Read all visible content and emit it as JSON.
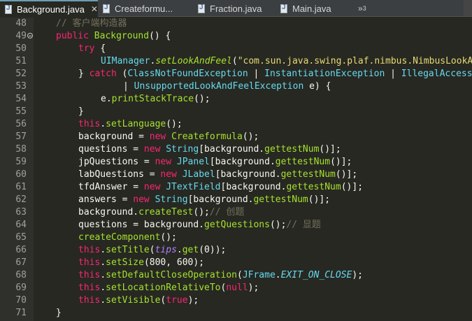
{
  "tabs": [
    {
      "label": "Background.java",
      "active": true,
      "closable": true
    },
    {
      "label": "Createformu...",
      "active": false,
      "closable": false
    },
    {
      "label": "Fraction.java",
      "active": false,
      "closable": false
    },
    {
      "label": "Main.java",
      "active": false,
      "closable": false
    }
  ],
  "overflow_label": "»",
  "overflow_count": "3",
  "colors": {
    "keyword": "#f92672",
    "type": "#66d9ef",
    "string": "#e6db74",
    "method": "#a6e22e",
    "comment": "#75715e",
    "background": "#272822"
  },
  "lines": [
    {
      "num": "48",
      "indent": 0,
      "tokens": [
        [
          "c",
          "// 客户端构造器"
        ]
      ]
    },
    {
      "num": "49",
      "fold": true,
      "indent": 0,
      "tokens": [
        [
          "k",
          "public "
        ],
        [
          "m",
          "Background"
        ],
        [
          "p",
          "() {"
        ]
      ]
    },
    {
      "num": "50",
      "indent": 1,
      "tokens": [
        [
          "k",
          "try "
        ],
        [
          "p",
          "{"
        ]
      ]
    },
    {
      "num": "51",
      "indent": 2,
      "tokens": [
        [
          "t",
          "UIManager"
        ],
        [
          "p",
          "."
        ],
        [
          "s",
          "setLookAndFeel"
        ],
        [
          "p",
          "("
        ],
        [
          "str",
          "\"com.sun.java.swing.plaf.nimbus.NimbusLookAndFeel\""
        ],
        [
          "p",
          ");"
        ]
      ]
    },
    {
      "num": "52",
      "indent": 1,
      "tokens": [
        [
          "p",
          "} "
        ],
        [
          "k",
          "catch "
        ],
        [
          "p",
          "("
        ],
        [
          "t",
          "ClassNotFoundException"
        ],
        [
          "p",
          " | "
        ],
        [
          "t",
          "InstantiationException"
        ],
        [
          "p",
          " | "
        ],
        [
          "t",
          "IllegalAccessException"
        ]
      ]
    },
    {
      "num": "53",
      "indent": 3,
      "tokens": [
        [
          "p",
          "| "
        ],
        [
          "t",
          "UnsupportedLookAndFeelException"
        ],
        [
          "p",
          " e) {"
        ]
      ]
    },
    {
      "num": "54",
      "indent": 2,
      "tokens": [
        [
          "p",
          "e."
        ],
        [
          "m",
          "printStackTrace"
        ],
        [
          "p",
          "();"
        ]
      ]
    },
    {
      "num": "55",
      "indent": 1,
      "tokens": [
        [
          "p",
          "}"
        ]
      ]
    },
    {
      "num": "56",
      "indent": 1,
      "tokens": [
        [
          "k",
          "this"
        ],
        [
          "p",
          "."
        ],
        [
          "m",
          "setLanguage"
        ],
        [
          "p",
          "();"
        ]
      ]
    },
    {
      "num": "57",
      "indent": 1,
      "tokens": [
        [
          "p",
          "background = "
        ],
        [
          "k",
          "new "
        ],
        [
          "m",
          "Createformula"
        ],
        [
          "p",
          "();"
        ]
      ]
    },
    {
      "num": "58",
      "indent": 1,
      "tokens": [
        [
          "p",
          "questions = "
        ],
        [
          "k",
          "new "
        ],
        [
          "t",
          "String"
        ],
        [
          "p",
          "[background."
        ],
        [
          "m",
          "gettestNum"
        ],
        [
          "p",
          "()];"
        ]
      ]
    },
    {
      "num": "59",
      "indent": 1,
      "tokens": [
        [
          "p",
          "jpQuestions = "
        ],
        [
          "k",
          "new "
        ],
        [
          "t",
          "JPanel"
        ],
        [
          "p",
          "[background."
        ],
        [
          "m",
          "gettestNum"
        ],
        [
          "p",
          "()];"
        ]
      ]
    },
    {
      "num": "60",
      "indent": 1,
      "tokens": [
        [
          "p",
          "labQuestions = "
        ],
        [
          "k",
          "new "
        ],
        [
          "t",
          "JLabel"
        ],
        [
          "p",
          "[background."
        ],
        [
          "m",
          "gettestNum"
        ],
        [
          "p",
          "()];"
        ]
      ]
    },
    {
      "num": "61",
      "indent": 1,
      "tokens": [
        [
          "p",
          "tfdAnswer = "
        ],
        [
          "k",
          "new "
        ],
        [
          "t",
          "JTextField"
        ],
        [
          "p",
          "[background."
        ],
        [
          "m",
          "gettestNum"
        ],
        [
          "p",
          "()];"
        ]
      ]
    },
    {
      "num": "62",
      "indent": 1,
      "tokens": [
        [
          "p",
          "answers = "
        ],
        [
          "k",
          "new "
        ],
        [
          "t",
          "String"
        ],
        [
          "p",
          "[background."
        ],
        [
          "m",
          "gettestNum"
        ],
        [
          "p",
          "()];"
        ]
      ]
    },
    {
      "num": "63",
      "indent": 1,
      "tokens": [
        [
          "p",
          "background."
        ],
        [
          "m",
          "createTest"
        ],
        [
          "p",
          "();"
        ],
        [
          "c",
          "// 创题"
        ]
      ]
    },
    {
      "num": "64",
      "indent": 1,
      "tokens": [
        [
          "p",
          "questions = background."
        ],
        [
          "m",
          "getQuestions"
        ],
        [
          "p",
          "();"
        ],
        [
          "c",
          "// 显题"
        ]
      ]
    },
    {
      "num": "65",
      "indent": 1,
      "tokens": [
        [
          "m",
          "createComponent"
        ],
        [
          "p",
          "();"
        ]
      ]
    },
    {
      "num": "66",
      "indent": 1,
      "tokens": [
        [
          "k",
          "this"
        ],
        [
          "p",
          "."
        ],
        [
          "m",
          "setTitle"
        ],
        [
          "p",
          "("
        ],
        [
          "f",
          "tips"
        ],
        [
          "p",
          "."
        ],
        [
          "m",
          "get"
        ],
        [
          "p",
          "(0));"
        ]
      ]
    },
    {
      "num": "67",
      "indent": 1,
      "tokens": [
        [
          "k",
          "this"
        ],
        [
          "p",
          "."
        ],
        [
          "m",
          "setSize"
        ],
        [
          "p",
          "(800, 600);"
        ]
      ]
    },
    {
      "num": "68",
      "indent": 1,
      "tokens": [
        [
          "k",
          "this"
        ],
        [
          "p",
          "."
        ],
        [
          "m",
          "setDefaultCloseOperation"
        ],
        [
          "p",
          "("
        ],
        [
          "t",
          "JFrame"
        ],
        [
          "p",
          "."
        ],
        [
          "si",
          "EXIT_ON_CLOSE"
        ],
        [
          "p",
          ");"
        ]
      ]
    },
    {
      "num": "69",
      "indent": 1,
      "tokens": [
        [
          "k",
          "this"
        ],
        [
          "p",
          "."
        ],
        [
          "m",
          "setLocationRelativeTo"
        ],
        [
          "p",
          "("
        ],
        [
          "k",
          "null"
        ],
        [
          "p",
          ");"
        ]
      ]
    },
    {
      "num": "70",
      "indent": 1,
      "tokens": [
        [
          "k",
          "this"
        ],
        [
          "p",
          "."
        ],
        [
          "m",
          "setVisible"
        ],
        [
          "p",
          "("
        ],
        [
          "k",
          "true"
        ],
        [
          "p",
          ");"
        ]
      ]
    },
    {
      "num": "71",
      "indent": 0,
      "tokens": [
        [
          "p",
          "}"
        ]
      ]
    }
  ]
}
